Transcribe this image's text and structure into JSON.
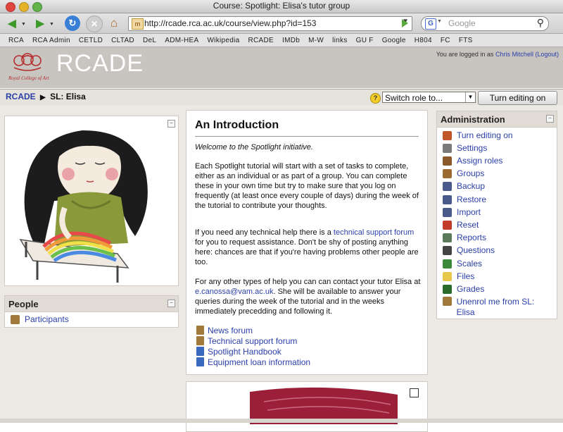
{
  "window": {
    "title": "Course: Spotlight: Elisa's tutor group"
  },
  "toolbar": {
    "url": "http://rcade.rca.ac.uk/course/view.php?id=153",
    "search_placeholder": "Google",
    "favicon_text": "m"
  },
  "bookmarks": [
    "RCA",
    "RCA Admin",
    "CETLD",
    "CLTAD",
    "DeL",
    "ADM-HEA",
    "Wikipedia",
    "RCADE",
    "IMDb",
    "M-W",
    "links",
    "GU F",
    "Google",
    "H804",
    "FC",
    "FTS"
  ],
  "banner": {
    "logo_text": "RCADE",
    "logo_small": "Royal College of Art",
    "logged_in_prefix": "You are logged in as",
    "user_name": "Chris Mitchell",
    "logout": "(Logout)"
  },
  "navbar": {
    "home": "RCADE",
    "separator": "▶",
    "current": "SL: Elisa",
    "role_select": "Switch role to...",
    "edit_button": "Turn editing on"
  },
  "people": {
    "header": "People",
    "participants": "Participants"
  },
  "intro": {
    "title": "An Introduction",
    "welcome": "Welcome to the Spotlight initiative.",
    "p1": "Each Spotlight tutorial will start with a set of tasks to complete, either as an individual or as part of a group. You can complete these in your own time but try to make sure that you log on frequently (at least once every couple of days) during the week of the tutorial to contribute your thoughts.",
    "p2_a": "If you need any technical help there is a ",
    "p2_link": "technical support forum",
    "p2_b": " for you to request assistance. Don't be shy of posting anything here: chances are that if you're having problems other people are too.",
    "p3_a": "For any other types of help you can can contact your tutor Elisa at ",
    "p3_email": "e.canossa@vam.ac.uk",
    "p3_b": ". She will be available to answer your queries during the week of the tutorial and in the weeks immediately precedding and following it.",
    "links": [
      "News forum",
      "Technical support forum",
      "Spotlight Handbook",
      "Equipment loan information"
    ]
  },
  "admin": {
    "header": "Administration",
    "items": [
      {
        "label": "Turn editing on",
        "icon": "pencil-icon",
        "color": "#c0572a"
      },
      {
        "label": "Settings",
        "icon": "settings-icon",
        "color": "#7a7a7a"
      },
      {
        "label": "Assign roles",
        "icon": "roles-icon",
        "color": "#8a5a2a"
      },
      {
        "label": "Groups",
        "icon": "groups-icon",
        "color": "#9a6a30"
      },
      {
        "label": "Backup",
        "icon": "backup-icon",
        "color": "#4a5a8a"
      },
      {
        "label": "Restore",
        "icon": "restore-icon",
        "color": "#4a5a8a"
      },
      {
        "label": "Import",
        "icon": "import-icon",
        "color": "#4a5a8a"
      },
      {
        "label": "Reset",
        "icon": "reset-icon",
        "color": "#c23a2a"
      },
      {
        "label": "Reports",
        "icon": "reports-icon",
        "color": "#5a7a5a"
      },
      {
        "label": "Questions",
        "icon": "questions-icon",
        "color": "#444444"
      },
      {
        "label": "Scales",
        "icon": "scales-icon",
        "color": "#3a8a3a"
      },
      {
        "label": "Files",
        "icon": "folder-icon",
        "color": "#e6c84a"
      },
      {
        "label": "Grades",
        "icon": "grades-icon",
        "color": "#2a6a2a"
      },
      {
        "label": "Unenrol me from SL: Elisa",
        "icon": "unenrol-icon",
        "color": "#a07a3a"
      }
    ]
  }
}
